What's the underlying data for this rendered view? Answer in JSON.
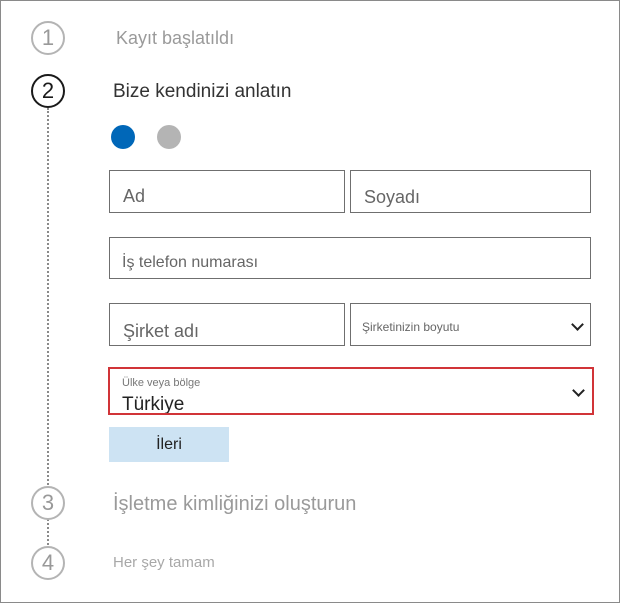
{
  "steps": [
    {
      "number": "1",
      "title": "Kayıt başlatıldı"
    },
    {
      "number": "2",
      "title": "Bize kendinizi anlatın"
    },
    {
      "number": "3",
      "title": "İşletme kimliğinizi oluşturun"
    },
    {
      "number": "4",
      "title": "Her şey tamam"
    }
  ],
  "progress_dots": {
    "active_color": "#0067b8",
    "inactive_color": "#b4b4b4",
    "current": 1,
    "total": 2
  },
  "form": {
    "first_name_placeholder": "Ad",
    "last_name_placeholder": "Soyadı",
    "phone_placeholder": "İş telefon numarası",
    "company_placeholder": "Şirket adı",
    "company_size_placeholder": "Şirketinizin boyutu",
    "country_label": "Ülke veya bölge",
    "country_value": "Türkiye",
    "next_label": "İleri"
  },
  "highlight_color": "#d13438"
}
